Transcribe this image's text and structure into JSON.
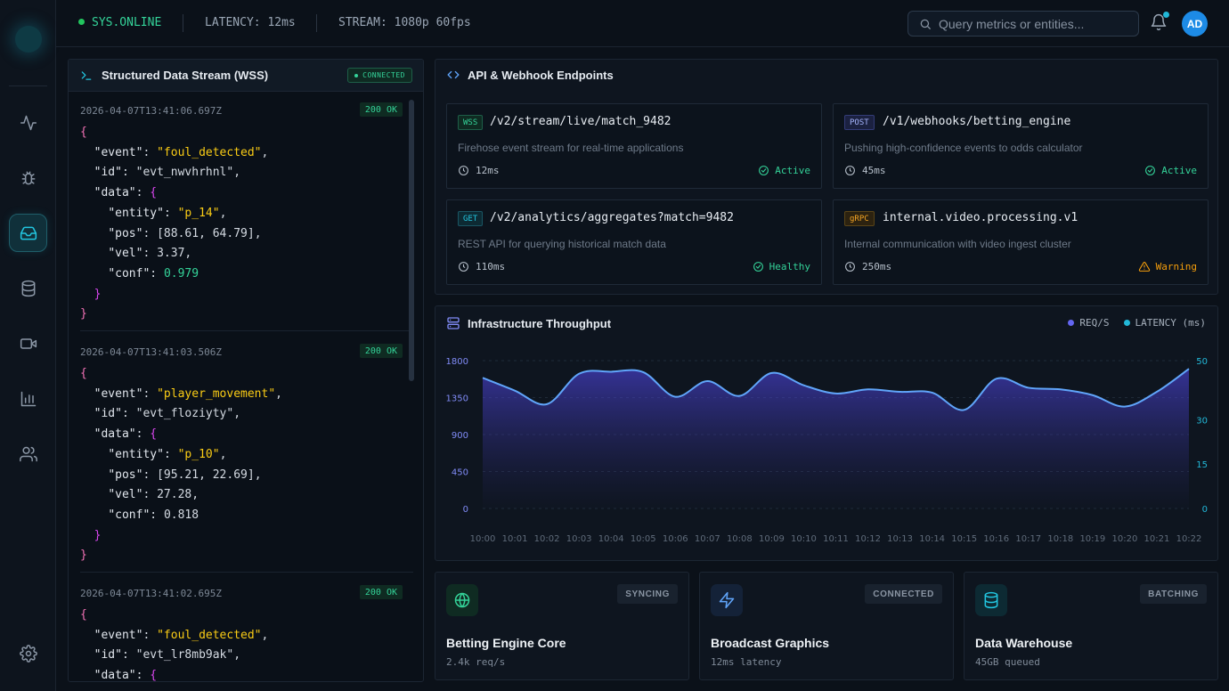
{
  "topbar": {
    "status": "SYS.ONLINE",
    "latency": "LATENCY: 12ms",
    "stream": "STREAM: 1080p 60fps",
    "search_placeholder": "Query metrics or entities...",
    "avatar": "AD"
  },
  "sidebar": {
    "items": [
      {
        "icon": "activity-icon"
      },
      {
        "icon": "bug-icon"
      },
      {
        "icon": "inbox-icon",
        "active": true
      },
      {
        "icon": "database-icon"
      },
      {
        "icon": "video-icon"
      },
      {
        "icon": "bar-chart-icon"
      },
      {
        "icon": "users-icon"
      }
    ],
    "bottom_icon": "settings-icon"
  },
  "stream": {
    "title": "Structured Data Stream (WSS)",
    "badge": "CONNECTED",
    "events": [
      {
        "timestamp": "2026-04-07T13:41:06.697Z",
        "status": "200 OK",
        "event": "\"foul_detected\"",
        "id": "\"evt_nwvhrhnl\"",
        "entity": "\"p_14\"",
        "pos": "[88.61, 64.79]",
        "vel": "3.37",
        "conf": "0.979"
      },
      {
        "timestamp": "2026-04-07T13:41:03.506Z",
        "status": "200 OK",
        "event": "\"player_movement\"",
        "id": "\"evt_floziyty\"",
        "entity": "\"p_10\"",
        "pos": "[95.21, 22.69]",
        "vel": "27.28",
        "conf": "0.818"
      },
      {
        "timestamp": "2026-04-07T13:41:02.695Z",
        "status": "200 OK",
        "event": "\"foul_detected\"",
        "id": "\"evt_lr8mb9ak\""
      }
    ]
  },
  "endpoints": {
    "title": "API & Webhook Endpoints",
    "items": [
      {
        "method": "WSS",
        "path": "/v2/stream/live/match_9482",
        "desc": "Firehose event stream for real-time applications",
        "latency": "12ms",
        "status": "Active",
        "status_color": "#34d399",
        "method_color": "#34d399",
        "method_bg": "#0f2b22"
      },
      {
        "method": "POST",
        "path": "/v1/webhooks/betting_engine",
        "desc": "Pushing high-confidence events to odds calculator",
        "latency": "45ms",
        "status": "Active",
        "status_color": "#34d399",
        "method_color": "#93a4ff",
        "method_bg": "#1b2140"
      },
      {
        "method": "GET",
        "path": "/v2/analytics/aggregates?match=9482",
        "desc": "REST API for querying historical match data",
        "latency": "110ms",
        "status": "Healthy",
        "status_color": "#34d399",
        "method_color": "#22c6e0",
        "method_bg": "#0d2a33"
      },
      {
        "method": "gRPC",
        "path": "internal.video.processing.v1",
        "desc": "Internal communication with video ingest cluster",
        "latency": "250ms",
        "status": "Warning",
        "status_color": "#f59e0b",
        "method_color": "#f5a524",
        "method_bg": "#2c2210"
      }
    ]
  },
  "throughput": {
    "title": "Infrastructure Throughput",
    "legend": [
      "REQ/S",
      "LATENCY (ms)"
    ]
  },
  "chart_data": {
    "type": "area",
    "x": [
      "10:00",
      "10:01",
      "10:02",
      "10:03",
      "10:04",
      "10:05",
      "10:06",
      "10:07",
      "10:08",
      "10:09",
      "10:10",
      "10:11",
      "10:12",
      "10:13",
      "10:14",
      "10:15",
      "10:16",
      "10:17",
      "10:18",
      "10:19",
      "10:20",
      "10:21",
      "10:22"
    ],
    "series": [
      {
        "name": "REQ/S",
        "values": [
          1590,
          1435,
          1270,
          1640,
          1665,
          1660,
          1360,
          1550,
          1370,
          1650,
          1500,
          1400,
          1450,
          1420,
          1410,
          1200,
          1580,
          1470,
          1450,
          1380,
          1240,
          1420,
          1700
        ]
      }
    ],
    "ylim_left": [
      0,
      1800
    ],
    "yticks_left": [
      0,
      450,
      900,
      1350,
      1800
    ],
    "ylim_right": [
      0,
      50
    ],
    "yticks_right": [
      0,
      15,
      30,
      50
    ],
    "colors": {
      "req": "#6366f1",
      "latency": "#22b8d8",
      "line": "#60a5fa"
    },
    "grid": true
  },
  "services": [
    {
      "title": "Betting Engine Core",
      "sub": "2.4k req/s",
      "badge": "SYNCING",
      "icon": "globe-icon",
      "color": "#34d399",
      "bg": "#0f2b22"
    },
    {
      "title": "Broadcast Graphics",
      "sub": "12ms latency",
      "badge": "CONNECTED",
      "icon": "zap-icon",
      "color": "#60a5fa",
      "bg": "#142238"
    },
    {
      "title": "Data Warehouse",
      "sub": "45GB queued",
      "badge": "BATCHING",
      "icon": "database-icon",
      "color": "#22c6e0",
      "bg": "#0d2a33"
    }
  ]
}
